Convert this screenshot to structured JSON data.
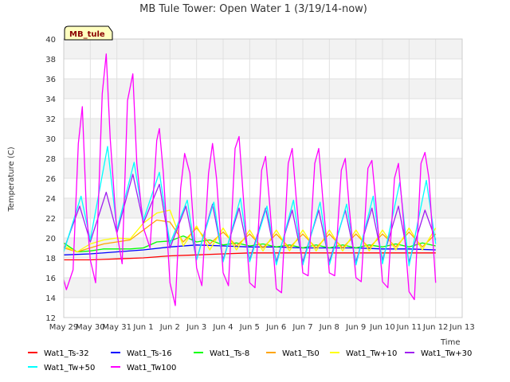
{
  "chart_data": {
    "type": "line",
    "title": "MB Tule Tower: Open Water 1 (3/19/14-now)",
    "xlabel": "Time",
    "ylabel": "Temperature (C)",
    "station_label": "MB_tule",
    "ylim": [
      12,
      40
    ],
    "xlim": [
      0,
      15
    ],
    "y_ticks": [
      12,
      14,
      16,
      18,
      20,
      22,
      24,
      26,
      28,
      30,
      32,
      34,
      36,
      38,
      40
    ],
    "x_ticks": [
      {
        "value": 0,
        "label": "May 29"
      },
      {
        "value": 1,
        "label": "May 30"
      },
      {
        "value": 2,
        "label": "May 31"
      },
      {
        "value": 3,
        "label": "Jun 1"
      },
      {
        "value": 4,
        "label": "Jun 2"
      },
      {
        "value": 5,
        "label": "Jun 3"
      },
      {
        "value": 6,
        "label": "Jun 4"
      },
      {
        "value": 7,
        "label": "Jun 5"
      },
      {
        "value": 8,
        "label": "Jun 6"
      },
      {
        "value": 9,
        "label": "Jun 7"
      },
      {
        "value": 10,
        "label": "Jun 8"
      },
      {
        "value": 11,
        "label": "Jun 9"
      },
      {
        "value": 12,
        "label": "Jun 10"
      },
      {
        "value": 13,
        "label": "Jun 11"
      },
      {
        "value": 14,
        "label": "Jun 12"
      },
      {
        "value": 15,
        "label": "Jun 13"
      }
    ],
    "grid": true,
    "legend_position": "bottom",
    "series": [
      {
        "name": "Wat1_Ts-32",
        "color": "#ff0000",
        "x": [
          0,
          1,
          2,
          3,
          4,
          5,
          6,
          7,
          8,
          9,
          10,
          11,
          12,
          13,
          14
        ],
        "y": [
          17.8,
          17.8,
          17.9,
          18.0,
          18.2,
          18.3,
          18.4,
          18.5,
          18.5,
          18.5,
          18.5,
          18.5,
          18.5,
          18.5,
          18.5
        ]
      },
      {
        "name": "Wat1_Ts-16",
        "color": "#0000ff",
        "x": [
          0,
          1,
          2,
          3,
          4,
          5,
          6,
          7,
          8,
          9,
          10,
          11,
          12,
          13,
          14
        ],
        "y": [
          18.3,
          18.4,
          18.6,
          18.8,
          19.1,
          19.3,
          19.2,
          19.1,
          19.1,
          19.0,
          19.0,
          19.0,
          18.9,
          18.9,
          18.8
        ]
      },
      {
        "name": "Wat1_Ts-8",
        "color": "#00ff00",
        "x": [
          0,
          0.5,
          1,
          1.5,
          2,
          2.5,
          3,
          3.5,
          4,
          4.5,
          5,
          5.5,
          6,
          6.5,
          7,
          7.5,
          8,
          8.5,
          9,
          9.5,
          10,
          10.5,
          11,
          11.5,
          12,
          12.5,
          13,
          13.5,
          14
        ],
        "y": [
          19.5,
          18.6,
          18.7,
          18.9,
          18.9,
          18.9,
          19.0,
          19.6,
          19.7,
          20.2,
          19.6,
          19.8,
          19.3,
          19.5,
          19.2,
          19.4,
          19.1,
          19.3,
          19.0,
          19.3,
          19.0,
          19.3,
          19.0,
          19.3,
          19.1,
          19.4,
          19.1,
          19.5,
          19.2
        ]
      },
      {
        "name": "Wat1_Ts0",
        "color": "#ffa500",
        "x": [
          0,
          0.5,
          1,
          1.5,
          2,
          2.5,
          3,
          3.5,
          4,
          4.5,
          5,
          5.5,
          6,
          6.5,
          7,
          7.5,
          8,
          8.5,
          9,
          9.5,
          10,
          10.5,
          11,
          11.5,
          12,
          12.5,
          13,
          13.5,
          14
        ],
        "y": [
          19.0,
          18.6,
          19.0,
          19.4,
          19.6,
          19.8,
          20.8,
          21.8,
          21.6,
          19.6,
          21.0,
          19.4,
          20.6,
          19.2,
          20.4,
          19.0,
          20.4,
          19.0,
          20.4,
          19.0,
          20.4,
          19.0,
          20.4,
          19.0,
          20.4,
          19.1,
          20.6,
          19.1,
          20.4
        ]
      },
      {
        "name": "Wat1_Tw+10",
        "color": "#ffff00",
        "x": [
          0,
          0.5,
          1,
          1.5,
          2,
          2.5,
          3,
          3.5,
          4,
          4.5,
          5,
          5.5,
          6,
          6.5,
          7,
          7.5,
          8,
          8.5,
          9,
          9.5,
          10,
          10.5,
          11,
          11.5,
          12,
          12.5,
          13,
          13.5,
          14
        ],
        "y": [
          19.2,
          18.6,
          19.4,
          19.8,
          20.0,
          19.9,
          21.5,
          22.5,
          22.8,
          19.2,
          21.2,
          18.8,
          21.0,
          18.8,
          20.8,
          18.7,
          20.8,
          18.7,
          20.8,
          18.7,
          20.8,
          18.7,
          20.8,
          18.7,
          20.8,
          18.8,
          21.0,
          18.8,
          21.0
        ]
      },
      {
        "name": "Wat1_Tw+30",
        "color": "#a020f0",
        "x": [
          0,
          0.6,
          1,
          1.6,
          2,
          2.6,
          3,
          3.6,
          4,
          4.6,
          5,
          5.6,
          6,
          6.6,
          7,
          7.6,
          8,
          8.6,
          9,
          9.6,
          10,
          10.6,
          11,
          11.6,
          12,
          12.6,
          13,
          13.6,
          14
        ],
        "y": [
          18.8,
          23.2,
          19.6,
          24.6,
          20.5,
          26.4,
          21.5,
          25.4,
          19.0,
          23.2,
          17.8,
          23.4,
          17.8,
          23.0,
          17.8,
          23.0,
          17.6,
          22.8,
          17.6,
          22.8,
          17.6,
          22.8,
          17.6,
          23.0,
          17.8,
          23.2,
          17.6,
          22.8,
          19.8
        ]
      },
      {
        "name": "Wat1_Tw+50",
        "color": "#00ffff",
        "x": [
          0,
          0.65,
          1,
          1.65,
          2,
          2.65,
          3,
          3.6,
          4,
          4.65,
          5,
          5.65,
          6,
          6.65,
          7,
          7.65,
          8,
          8.65,
          9,
          9.65,
          10,
          10.65,
          11,
          11.65,
          12,
          12.65,
          13,
          13.65,
          14
        ],
        "y": [
          18.6,
          24.2,
          19.8,
          29.2,
          20.8,
          27.6,
          21.8,
          26.6,
          19.4,
          23.8,
          17.8,
          23.6,
          17.6,
          24.0,
          17.6,
          23.2,
          17.3,
          23.8,
          17.3,
          23.6,
          17.3,
          23.4,
          17.3,
          24.2,
          17.4,
          25.6,
          17.2,
          25.8,
          19.4
        ]
      },
      {
        "name": "Wat1_Tw100",
        "color": "#ff00ff",
        "x": [
          0,
          0.1,
          0.35,
          0.55,
          0.7,
          0.85,
          1.0,
          1.2,
          1.45,
          1.6,
          1.75,
          2.0,
          2.2,
          2.4,
          2.6,
          2.75,
          3.0,
          3.25,
          3.5,
          3.6,
          3.75,
          4.0,
          4.2,
          4.4,
          4.55,
          4.75,
          5.0,
          5.2,
          5.45,
          5.6,
          5.75,
          6.0,
          6.2,
          6.45,
          6.6,
          6.75,
          7.0,
          7.2,
          7.45,
          7.6,
          7.75,
          8.0,
          8.2,
          8.45,
          8.6,
          8.75,
          9.0,
          9.2,
          9.45,
          9.6,
          9.75,
          10.0,
          10.2,
          10.45,
          10.6,
          10.75,
          11.0,
          11.2,
          11.45,
          11.6,
          11.75,
          12.0,
          12.2,
          12.45,
          12.6,
          12.75,
          13.0,
          13.2,
          13.45,
          13.6,
          13.75,
          14.0
        ],
        "y": [
          15.8,
          14.8,
          16.8,
          29.5,
          33.2,
          23.0,
          17.8,
          15.5,
          34.5,
          38.5,
          30.0,
          20.5,
          17.4,
          33.8,
          36.5,
          27.5,
          21.0,
          19.0,
          29.8,
          31.0,
          26.5,
          15.5,
          13.2,
          25.0,
          28.5,
          26.5,
          17.0,
          15.2,
          26.5,
          29.5,
          26.0,
          16.5,
          15.2,
          29.0,
          30.2,
          24.5,
          15.5,
          15.0,
          26.8,
          28.2,
          23.5,
          14.9,
          14.5,
          27.5,
          29.0,
          24.0,
          16.5,
          16.2,
          27.5,
          29.0,
          24.0,
          16.5,
          16.2,
          26.8,
          28.0,
          23.0,
          16.0,
          15.6,
          27.0,
          27.8,
          23.5,
          15.6,
          15.0,
          26.0,
          27.5,
          23.0,
          14.6,
          13.8,
          27.5,
          28.6,
          26.0,
          15.5
        ]
      }
    ]
  }
}
